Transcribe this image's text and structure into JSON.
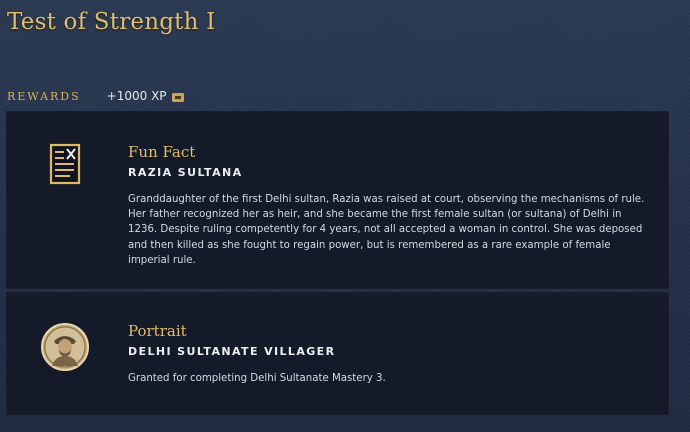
{
  "page": {
    "title": "Test of Strength I"
  },
  "rewards": {
    "label": "REWARDS",
    "xp_text": "+1000 XP",
    "xp_icon": "xp-badge-icon"
  },
  "cards": [
    {
      "icon": "scroll-document-icon",
      "title": "Fun Fact",
      "subtitle": "RAZIA SULTANA",
      "text": "Granddaughter of the first Delhi sultan, Razia was raised at court, observing the mechanisms of rule. Her father recognized her as heir, and she became the first female sultan (or sultana) of Delhi in 1236. Despite ruling competently for 4 years, not all accepted a woman in control. She was deposed and then killed as she fought to regain power, but is remembered as a rare example of female imperial rule."
    },
    {
      "icon": "villager-portrait-icon",
      "title": "Portrait",
      "subtitle": "DELHI SULTANATE VILLAGER",
      "text": "Granted for completing Delhi Sultanate Mastery 3."
    }
  ],
  "colors": {
    "accent_gold": "#e3bd6d",
    "card_bg": "#141a28",
    "page_bg": "#26344a"
  }
}
